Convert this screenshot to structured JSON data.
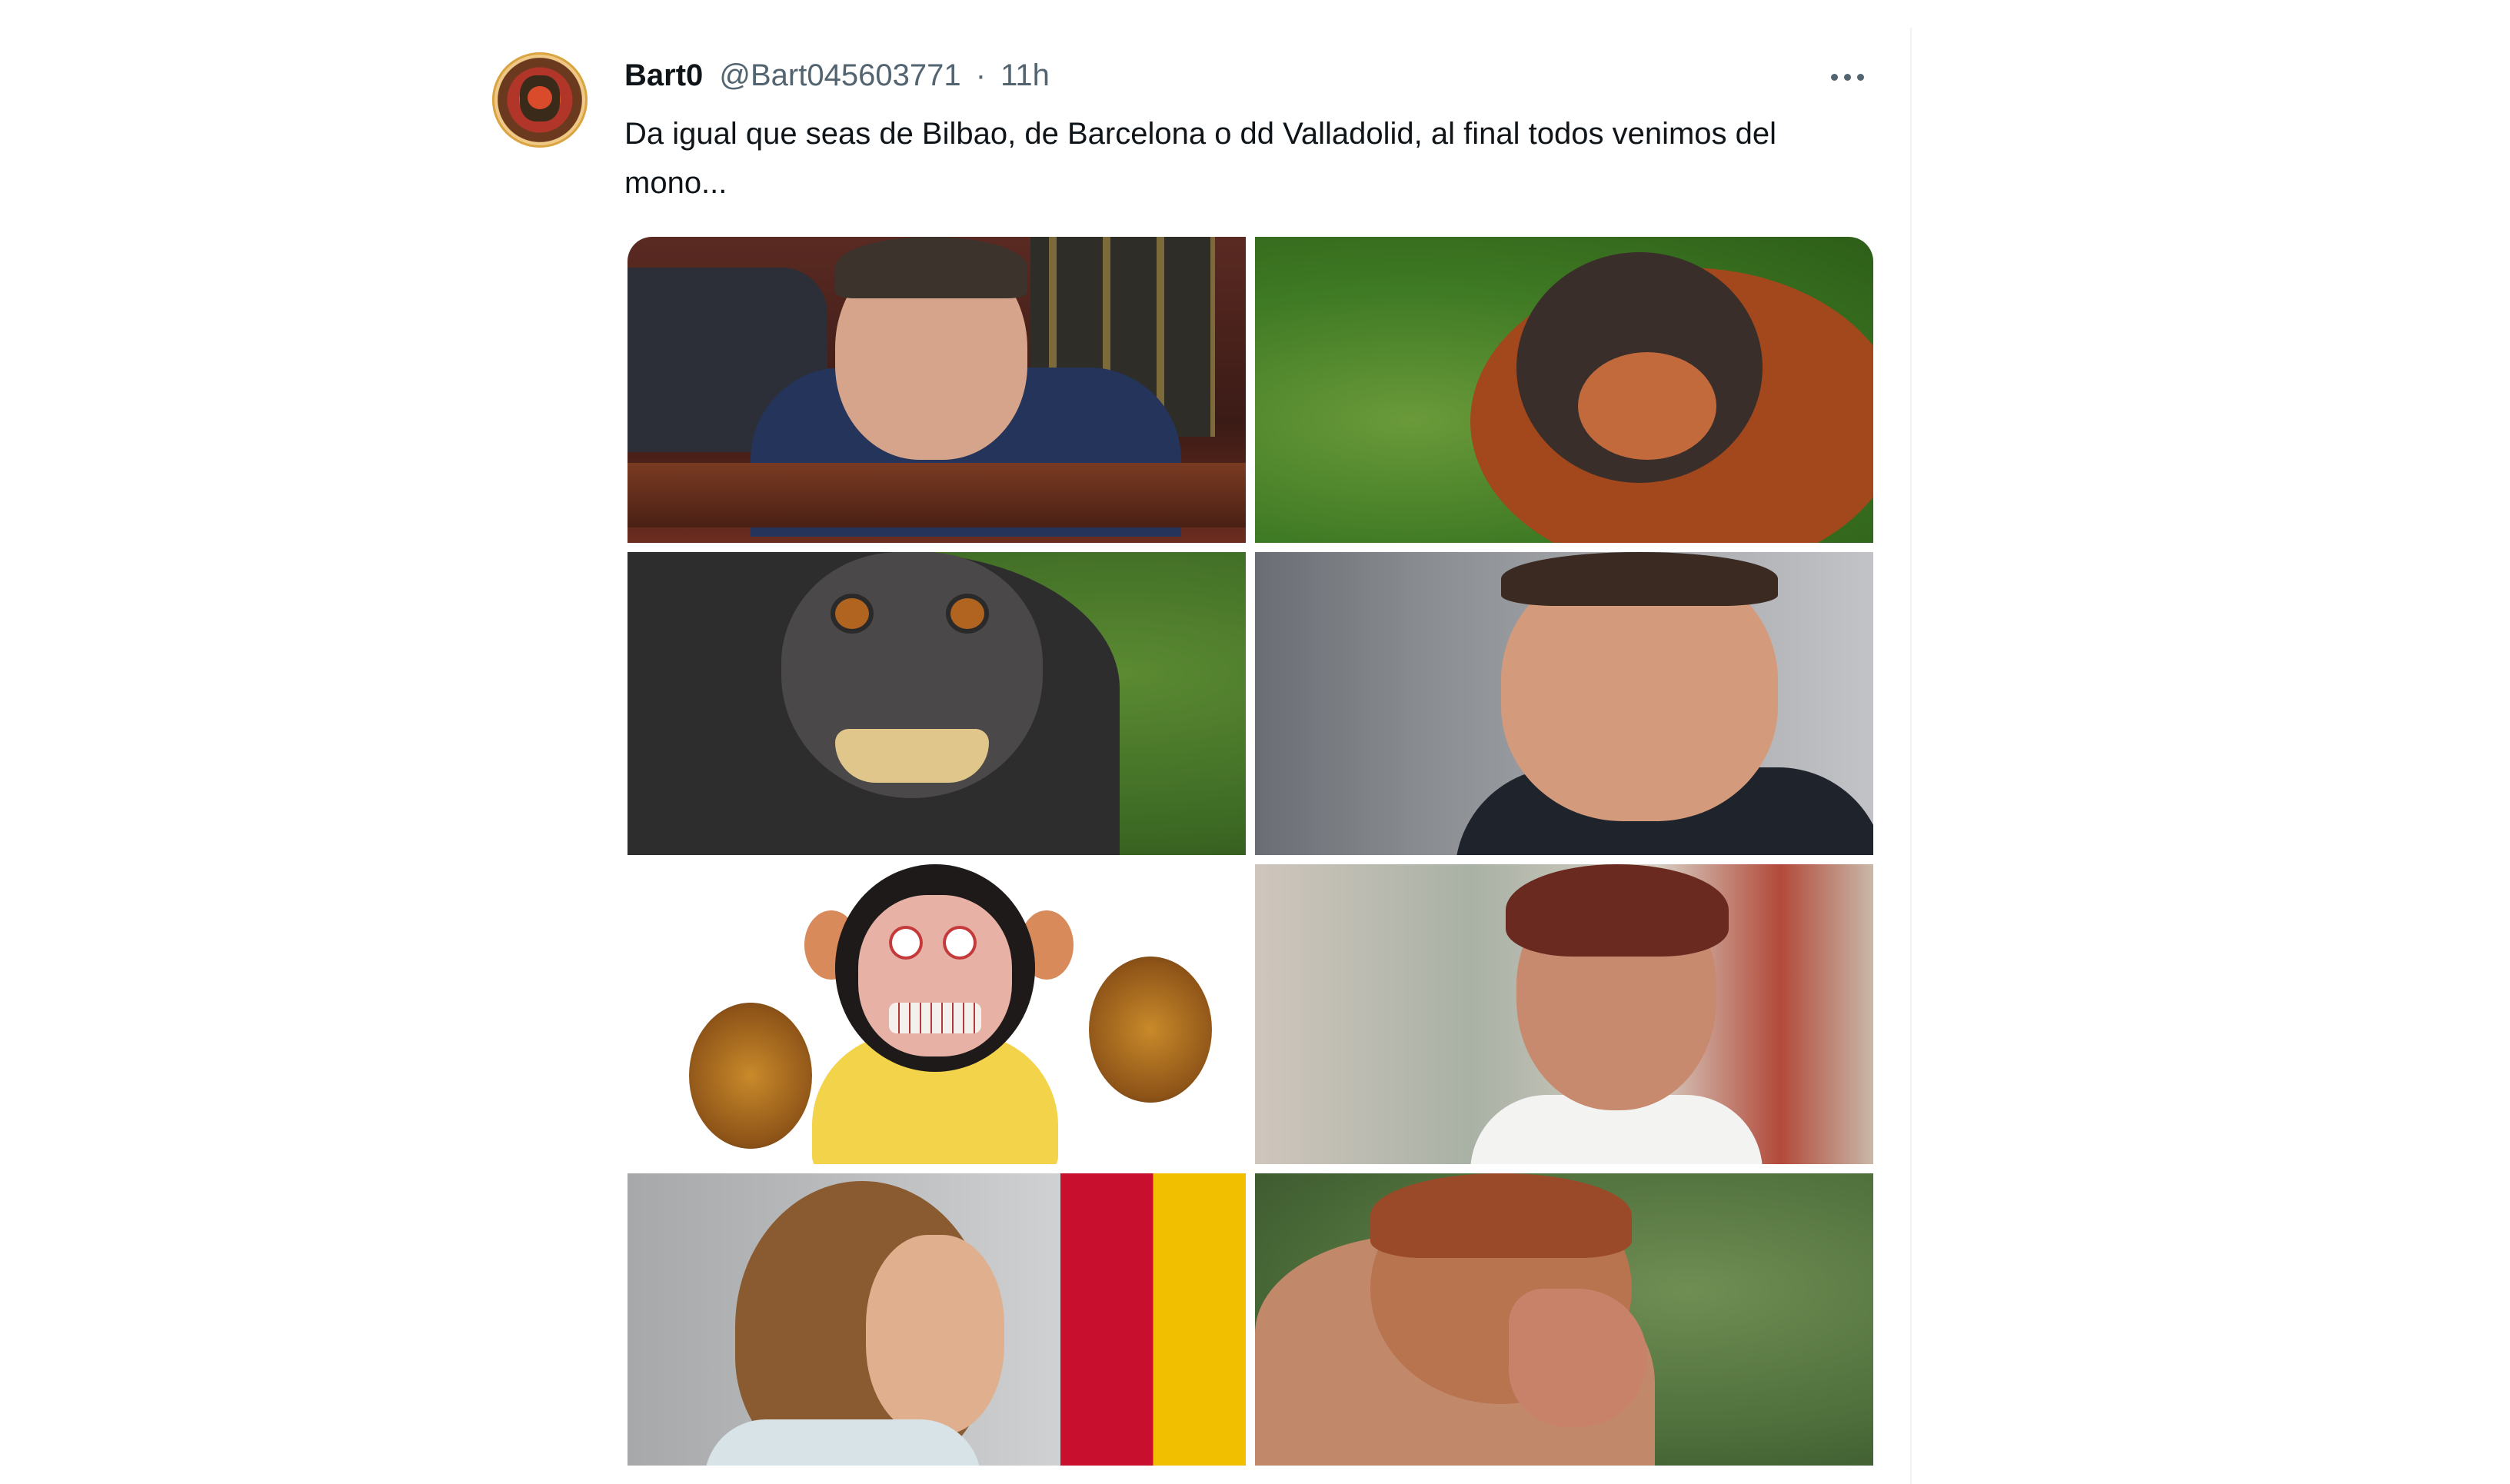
{
  "tweet": {
    "author_name": "Bart0",
    "author_handle": "@Bart045603771",
    "separator": "·",
    "time": "11h",
    "text": "Da igual que seas de Bilbao, de Barcelona o dd Valladolid, al final todos venimos del mono...",
    "more_icon": "more-horizontal-icon"
  },
  "media": {
    "count": 8,
    "images": [
      {
        "subject": "politician-parliament"
      },
      {
        "subject": "orangutan"
      },
      {
        "subject": "macaque-selfie"
      },
      {
        "subject": "politician-man"
      },
      {
        "subject": "cymbal-monkey-toy"
      },
      {
        "subject": "politician-woman"
      },
      {
        "subject": "politician-woman-profile"
      },
      {
        "subject": "proboscis-monkey"
      }
    ]
  },
  "colors": {
    "text_primary": "#0f1419",
    "text_secondary": "#536471",
    "divider": "#eff3f4"
  }
}
